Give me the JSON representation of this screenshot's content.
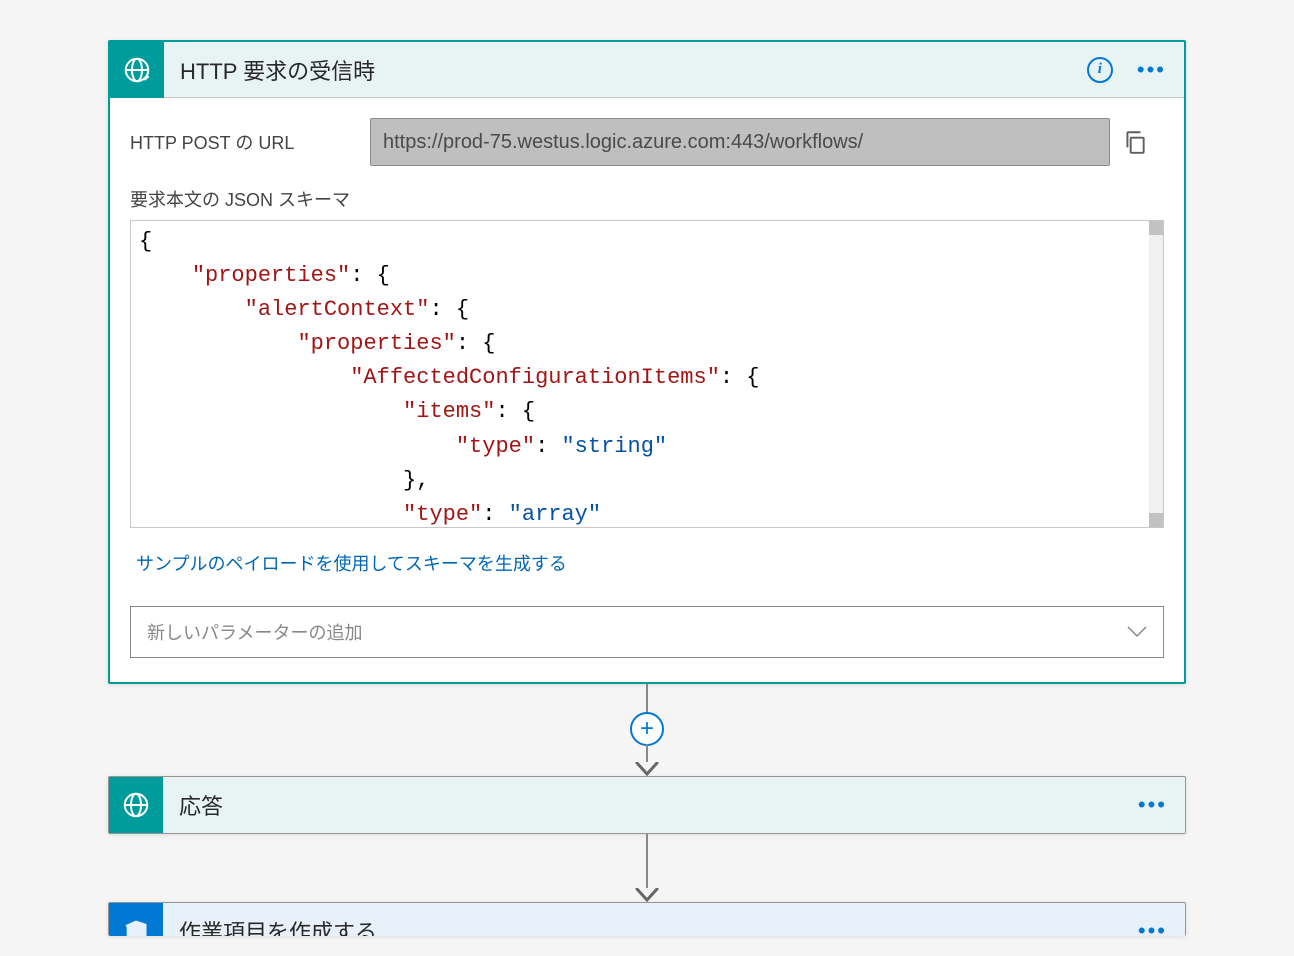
{
  "card1": {
    "title": "HTTP 要求の受信時",
    "url_label": "HTTP POST の URL",
    "url_value": "https://prod-75.westus.logic.azure.com:443/workflows/",
    "schema_label": "要求本文の JSON スキーマ",
    "gen_link": "サンプルのペイロードを使用してスキーマを生成する",
    "param_placeholder": "新しいパラメーターの追加",
    "schema_tokens": [
      [
        {
          "t": "punc",
          "v": "{"
        }
      ],
      [
        {
          "t": "pad",
          "v": "    "
        },
        {
          "t": "key",
          "v": "\"properties\""
        },
        {
          "t": "punc",
          "v": ": {"
        }
      ],
      [
        {
          "t": "pad",
          "v": "        "
        },
        {
          "t": "key",
          "v": "\"alertContext\""
        },
        {
          "t": "punc",
          "v": ": {"
        }
      ],
      [
        {
          "t": "pad",
          "v": "            "
        },
        {
          "t": "key",
          "v": "\"properties\""
        },
        {
          "t": "punc",
          "v": ": {"
        }
      ],
      [
        {
          "t": "pad",
          "v": "                "
        },
        {
          "t": "key",
          "v": "\"AffectedConfigurationItems\""
        },
        {
          "t": "punc",
          "v": ": {"
        }
      ],
      [
        {
          "t": "pad",
          "v": "                    "
        },
        {
          "t": "key",
          "v": "\"items\""
        },
        {
          "t": "punc",
          "v": ": {"
        }
      ],
      [
        {
          "t": "pad",
          "v": "                        "
        },
        {
          "t": "key",
          "v": "\"type\""
        },
        {
          "t": "punc",
          "v": ": "
        },
        {
          "t": "val",
          "v": "\"string\""
        }
      ],
      [
        {
          "t": "pad",
          "v": "                    "
        },
        {
          "t": "punc",
          "v": "},"
        }
      ],
      [
        {
          "t": "pad",
          "v": "                    "
        },
        {
          "t": "key",
          "v": "\"type\""
        },
        {
          "t": "punc",
          "v": ": "
        },
        {
          "t": "val",
          "v": "\"array\""
        }
      ]
    ]
  },
  "card2": {
    "title": "応答"
  },
  "card3": {
    "title": "作業項目を作成する"
  }
}
